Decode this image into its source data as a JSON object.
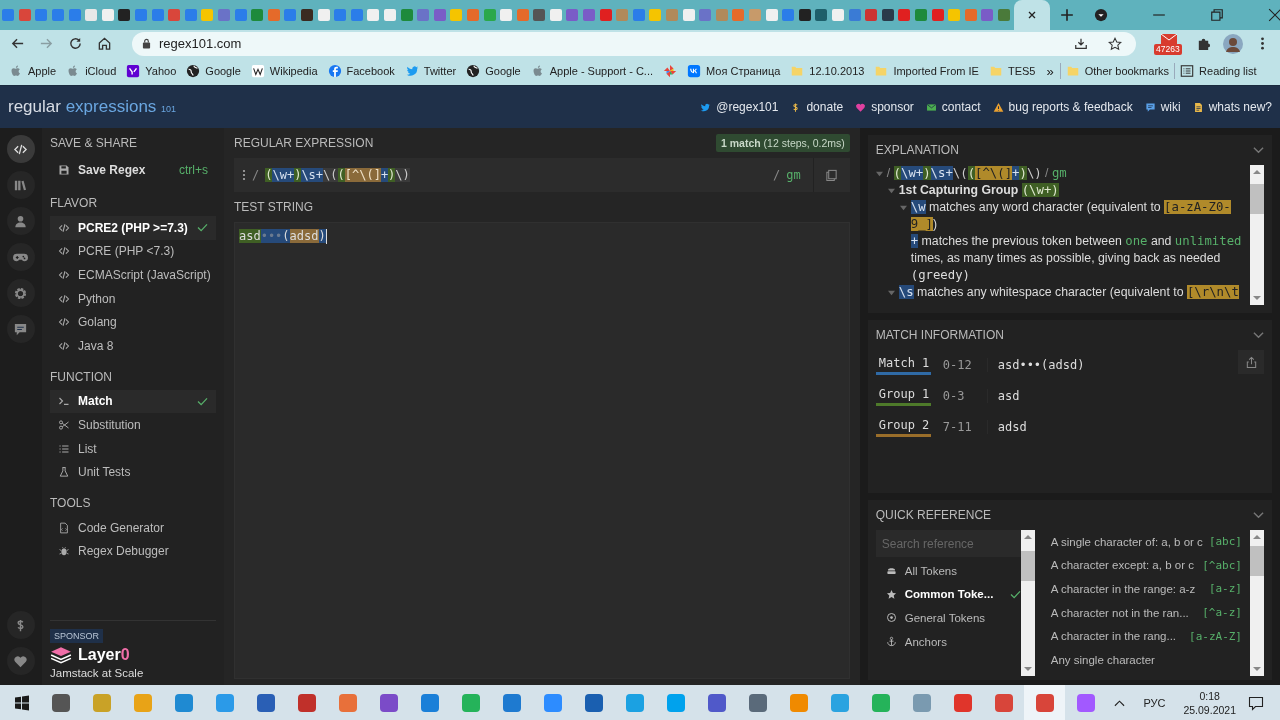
{
  "browser": {
    "tabs": [
      {
        "color": "#2b7de9",
        "selected": false
      },
      {
        "color": "#d9463b",
        "selected": false
      },
      {
        "color": "#2b7de9",
        "selected": false
      },
      {
        "color": "#2b7de9",
        "selected": false
      },
      {
        "color": "#2b7de9",
        "selected": false
      },
      {
        "color": "#e8e8e8",
        "selected": false
      },
      {
        "color": "#f0f0f0",
        "selected": false
      },
      {
        "color": "#222222",
        "selected": false
      },
      {
        "color": "#2b7de9",
        "selected": false
      },
      {
        "color": "#2b7de9",
        "selected": false
      },
      {
        "color": "#d9463b",
        "selected": false
      },
      {
        "color": "#2b7de9",
        "selected": false
      },
      {
        "color": "#f5c400",
        "selected": false
      },
      {
        "color": "#6a72c7",
        "selected": false
      },
      {
        "color": "#2b7de9",
        "selected": false
      },
      {
        "color": "#1e8a3c",
        "selected": false
      },
      {
        "color": "#e56a2a",
        "selected": false
      },
      {
        "color": "#2b7de9",
        "selected": false
      },
      {
        "color": "#3a2a20",
        "selected": false
      },
      {
        "color": "#f0f0f0",
        "selected": false
      },
      {
        "color": "#2b7de9",
        "selected": false
      },
      {
        "color": "#2b7de9",
        "selected": false
      },
      {
        "color": "#f0f0f0",
        "selected": false
      },
      {
        "color": "#f0f0f0",
        "selected": false
      },
      {
        "color": "#1e8a3c",
        "selected": false
      },
      {
        "color": "#6a72c7",
        "selected": false
      },
      {
        "color": "#7a5cc7",
        "selected": false
      },
      {
        "color": "#f5c400",
        "selected": false
      },
      {
        "color": "#e56a2a",
        "selected": false
      },
      {
        "color": "#2ba84a",
        "selected": false
      },
      {
        "color": "#f0f0f0",
        "selected": false
      },
      {
        "color": "#e56a2a",
        "selected": false
      },
      {
        "color": "#555555",
        "selected": false
      },
      {
        "color": "#f0f0f0",
        "selected": false
      },
      {
        "color": "#7a5cc7",
        "selected": false
      },
      {
        "color": "#7a5cc7",
        "selected": false
      },
      {
        "color": "#e02020",
        "selected": false
      },
      {
        "color": "#b08a5a",
        "selected": false
      },
      {
        "color": "#2b7de9",
        "selected": false
      },
      {
        "color": "#f5c400",
        "selected": false
      },
      {
        "color": "#b08a5a",
        "selected": false
      },
      {
        "color": "#f0f0f0",
        "selected": false
      },
      {
        "color": "#6a72c7",
        "selected": false
      },
      {
        "color": "#b08a5a",
        "selected": false
      },
      {
        "color": "#e56a2a",
        "selected": false
      },
      {
        "color": "#c79a6a",
        "selected": false
      },
      {
        "color": "#f0f0f0",
        "selected": false
      },
      {
        "color": "#2b7de9",
        "selected": false
      },
      {
        "color": "#222222",
        "selected": false
      },
      {
        "color": "#1e5f6a",
        "selected": false
      },
      {
        "color": "#f0f0f0",
        "selected": false
      },
      {
        "color": "#3a7bd5",
        "selected": false
      },
      {
        "color": "#cc3333",
        "selected": false
      },
      {
        "color": "#2a3a4a",
        "selected": false
      },
      {
        "color": "#e02020",
        "selected": false
      },
      {
        "color": "#1e8a3c",
        "selected": false
      },
      {
        "color": "#e02020",
        "selected": false
      },
      {
        "color": "#f5c400",
        "selected": false
      },
      {
        "color": "#e56a2a",
        "selected": false
      },
      {
        "color": "#7a5cc7",
        "selected": false
      },
      {
        "color": "#4a7a3a",
        "selected": false
      },
      {
        "selected": true
      }
    ],
    "address": "regex101.com",
    "mail_badge": "47263",
    "bookmarks": [
      {
        "label": "Apple",
        "kind": "apple"
      },
      {
        "label": "iCloud",
        "kind": "apple"
      },
      {
        "label": "Yahoo",
        "kind": "yahoo"
      },
      {
        "label": "Google",
        "kind": "globe"
      },
      {
        "label": "Wikipedia",
        "kind": "wiki"
      },
      {
        "label": "Facebook",
        "kind": "facebook"
      },
      {
        "label": "Twitter",
        "kind": "twitter"
      },
      {
        "label": "Google",
        "kind": "globe"
      },
      {
        "label": "Apple - Support - C...",
        "kind": "apple"
      },
      {
        "kind": "pinwheel"
      },
      {
        "label": "Моя Страница",
        "kind": "vk"
      },
      {
        "label": "12.10.2013",
        "kind": "folder"
      },
      {
        "label": "Imported From IE",
        "kind": "folder"
      },
      {
        "label": "TES5",
        "kind": "folder"
      }
    ],
    "overflow": "»",
    "other_bookmarks": "Other bookmarks",
    "reading_list": "Reading list"
  },
  "header": {
    "logo": "regular",
    "logo_accent": "expressions",
    "logo_version": "101",
    "links": [
      {
        "label": "@regex101",
        "kind": "twitter"
      },
      {
        "label": "donate",
        "kind": "dollar"
      },
      {
        "label": "sponsor",
        "kind": "heart"
      },
      {
        "label": "contact",
        "kind": "mail"
      },
      {
        "label": "bug reports & feedback",
        "kind": "warning"
      },
      {
        "label": "wiki",
        "kind": "chat"
      },
      {
        "label": "whats new?",
        "kind": "doc"
      }
    ]
  },
  "rail": [
    {
      "kind": "code",
      "selected": true
    },
    {
      "kind": "library",
      "selected": false
    },
    {
      "kind": "user",
      "selected": false
    },
    {
      "kind": "gamepad",
      "selected": false
    },
    {
      "kind": "gear",
      "selected": false
    },
    {
      "kind": "chat",
      "selected": false
    },
    {
      "kind": "dollar",
      "selected": false
    },
    {
      "kind": "heart",
      "selected": false
    }
  ],
  "sidebar": {
    "sections": [
      {
        "title": "SAVE & SHARE",
        "items": [
          {
            "label": "Save Regex",
            "kind": "save",
            "shortcut": "ctrl+s",
            "selected": false
          }
        ]
      },
      {
        "title": "FLAVOR",
        "items": [
          {
            "label": "PCRE2 (PHP >=7.3)",
            "kind": "code",
            "selected": true
          },
          {
            "label": "PCRE (PHP <7.3)",
            "kind": "code",
            "selected": false
          },
          {
            "label": "ECMAScript (JavaScript)",
            "kind": "code",
            "selected": false
          },
          {
            "label": "Python",
            "kind": "code",
            "selected": false
          },
          {
            "label": "Golang",
            "kind": "code",
            "selected": false
          },
          {
            "label": "Java 8",
            "kind": "code",
            "selected": false
          }
        ]
      },
      {
        "title": "FUNCTION",
        "items": [
          {
            "label": "Match",
            "kind": "terminal",
            "selected": true
          },
          {
            "label": "Substitution",
            "kind": "scissors",
            "selected": false
          },
          {
            "label": "List",
            "kind": "list",
            "selected": false
          },
          {
            "label": "Unit Tests",
            "kind": "flask",
            "selected": false
          }
        ]
      },
      {
        "title": "TOOLS",
        "items": [
          {
            "label": "Code Generator",
            "kind": "file",
            "selected": false
          },
          {
            "label": "Regex Debugger",
            "kind": "bug",
            "selected": false
          }
        ]
      }
    ],
    "sponsor": {
      "badge": "SPONSOR",
      "name": "Layer",
      "name_accent": "0",
      "tagline": "Jamstack at Scale"
    }
  },
  "regex": {
    "title": "REGULAR EXPRESSION",
    "status": "**1 match** (12 steps, 0.2ms)",
    "delimiter": "/",
    "flags_delimiter": "/",
    "flags": "gm",
    "tokens": [
      {
        "text": "(",
        "kind": "group"
      },
      {
        "text": "\\w+",
        "kind": "token"
      },
      {
        "text": ")",
        "kind": "group"
      },
      {
        "text": "\\s+",
        "kind": "token"
      },
      {
        "text": "\\(",
        "kind": "plain"
      },
      {
        "text": "(",
        "kind": "group"
      },
      {
        "text": "[^\\(]",
        "kind": "class"
      },
      {
        "text": "+",
        "kind": "token"
      },
      {
        "text": ")",
        "kind": "group"
      },
      {
        "text": "\\)",
        "kind": "plain"
      }
    ]
  },
  "test": {
    "title": "TEST STRING",
    "segments": [
      {
        "text": "asd",
        "kind": "group1"
      },
      {
        "text": "•••",
        "kind": "space"
      },
      {
        "text": "(",
        "kind": "match"
      },
      {
        "text": "adsd",
        "kind": "group2"
      },
      {
        "text": ")",
        "kind": "match"
      }
    ]
  },
  "explanation": {
    "title": "EXPLANATION",
    "tree": [
      {
        "kind": "node",
        "expanded": true,
        "parts": [
          {
            "text": "/ ",
            "kind": "muted"
          },
          {
            "text": "(",
            "kind": "group"
          },
          {
            "text": "\\w+",
            "kind": "token"
          },
          {
            "text": ")",
            "kind": "group"
          },
          {
            "text": "\\s+",
            "kind": "token"
          },
          {
            "text": "\\(",
            "kind": "plain"
          },
          {
            "text": "(",
            "kind": "group"
          },
          {
            "text": "[^\\(]",
            "kind": "rclass"
          },
          {
            "text": "+",
            "kind": "token"
          },
          {
            "text": ")",
            "kind": "group"
          },
          {
            "text": "\\)",
            "kind": "plain"
          },
          {
            "text": " / ",
            "kind": "muted"
          },
          {
            "text": "gm",
            "kind": "quant"
          }
        ],
        "children": [
          {
            "kind": "node",
            "expanded": true,
            "parts": [
              {
                "text": "1st Capturing Group ",
                "kind": "bold"
              },
              {
                "text": "(\\w+)",
                "kind": "group"
              }
            ],
            "children": [
              {
                "kind": "node",
                "expanded": true,
                "parts": [
                  {
                    "text": "\\w",
                    "kind": "token"
                  },
                  {
                    "text": " matches any word character (equivalent to ",
                    "kind": "text"
                  },
                  {
                    "text": "[a-zA-Z0-9_]",
                    "kind": "class"
                  },
                  {
                    "text": ")",
                    "kind": "text"
                  }
                ]
              },
              {
                "kind": "leaf",
                "parts": [
                  {
                    "text": "+",
                    "kind": "token"
                  },
                  {
                    "text": " matches the previous token between ",
                    "kind": "text"
                  },
                  {
                    "text": "one",
                    "kind": "quant"
                  },
                  {
                    "text": " and ",
                    "kind": "text"
                  },
                  {
                    "text": "unlimited",
                    "kind": "quant"
                  },
                  {
                    "text": " times, as many times as possible, giving back as needed ",
                    "kind": "text"
                  },
                  {
                    "text": "(greedy)",
                    "kind": "mono"
                  }
                ]
              }
            ]
          },
          {
            "kind": "node",
            "expanded": true,
            "parts": [
              {
                "text": "\\s",
                "kind": "token"
              },
              {
                "text": " matches any whitespace character (equivalent to ",
                "kind": "text"
              },
              {
                "text": "[\\r\\n\\t",
                "kind": "class"
              }
            ]
          }
        ]
      }
    ]
  },
  "match_info": {
    "title": "MATCH INFORMATION",
    "rows": [
      {
        "label": "Match 1",
        "range": "0-12",
        "value": "asd•••(adsd)",
        "color": "#2f6aa6"
      },
      {
        "label": "Group 1",
        "range": "0-3",
        "value": "asd",
        "color": "#4e7a2a"
      },
      {
        "label": "Group 2",
        "range": "7-11",
        "value": "adsd",
        "color": "#9a6e2a"
      }
    ]
  },
  "quick_reference": {
    "title": "QUICK REFERENCE",
    "search": {
      "placeholder": "Search reference"
    },
    "categories": [
      {
        "label": "All Tokens",
        "kind": "stack",
        "selected": false
      },
      {
        "label": "Common Toke...",
        "kind": "star",
        "selected": true
      },
      {
        "label": "General Tokens",
        "kind": "target",
        "selected": false
      },
      {
        "label": "Anchors",
        "kind": "anchor",
        "selected": false
      }
    ],
    "items": [
      {
        "text": "A single character of: a, b or c",
        "token": "[abc]"
      },
      {
        "text": "A character except: a, b or c",
        "token": "[^abc]"
      },
      {
        "text": "A character in the range: a-z",
        "token": "[a-z]"
      },
      {
        "text": "A character not in the ran...",
        "token": "[^a-z]"
      },
      {
        "text": "A character in the rang...",
        "token": "[a-zA-Z]"
      },
      {
        "text": "Any single character"
      }
    ]
  },
  "taskbar": {
    "apps": [
      {
        "color": "#555555",
        "selected": false
      },
      {
        "color": "#c9a227",
        "selected": false
      },
      {
        "color": "#e8a317",
        "selected": false
      },
      {
        "color": "#1f8ad2",
        "selected": false
      },
      {
        "color": "#2b9ae8",
        "selected": false
      },
      {
        "color": "#2a5fb5",
        "selected": false
      },
      {
        "color": "#c0302a",
        "selected": false
      },
      {
        "color": "#e8703a",
        "selected": false
      },
      {
        "color": "#7b4bc8",
        "selected": false
      },
      {
        "color": "#1a7fd8",
        "selected": false
      },
      {
        "color": "#25b35a",
        "selected": false
      },
      {
        "color": "#1e7ad0",
        "selected": false
      },
      {
        "color": "#2d8cff",
        "selected": false
      },
      {
        "color": "#1a5fb0",
        "selected": false
      },
      {
        "color": "#1ba1e2",
        "selected": false
      },
      {
        "color": "#00a2ed",
        "selected": false
      },
      {
        "color": "#5059c9",
        "selected": false
      },
      {
        "color": "#5a6a7a",
        "selected": false
      },
      {
        "color": "#f08a00",
        "selected": false
      },
      {
        "color": "#2aa3e0",
        "selected": false
      },
      {
        "color": "#25b35a",
        "selected": false
      },
      {
        "color": "#7a9ab0",
        "selected": false
      },
      {
        "color": "#e0352b",
        "selected": false
      },
      {
        "color": "#d8453a",
        "selected": false
      },
      {
        "color": "#d8453a",
        "selected": true
      },
      {
        "color": "#a259ff",
        "selected": false
      }
    ],
    "language": "РУС",
    "time": "0:18",
    "date": "25.09.2021"
  }
}
